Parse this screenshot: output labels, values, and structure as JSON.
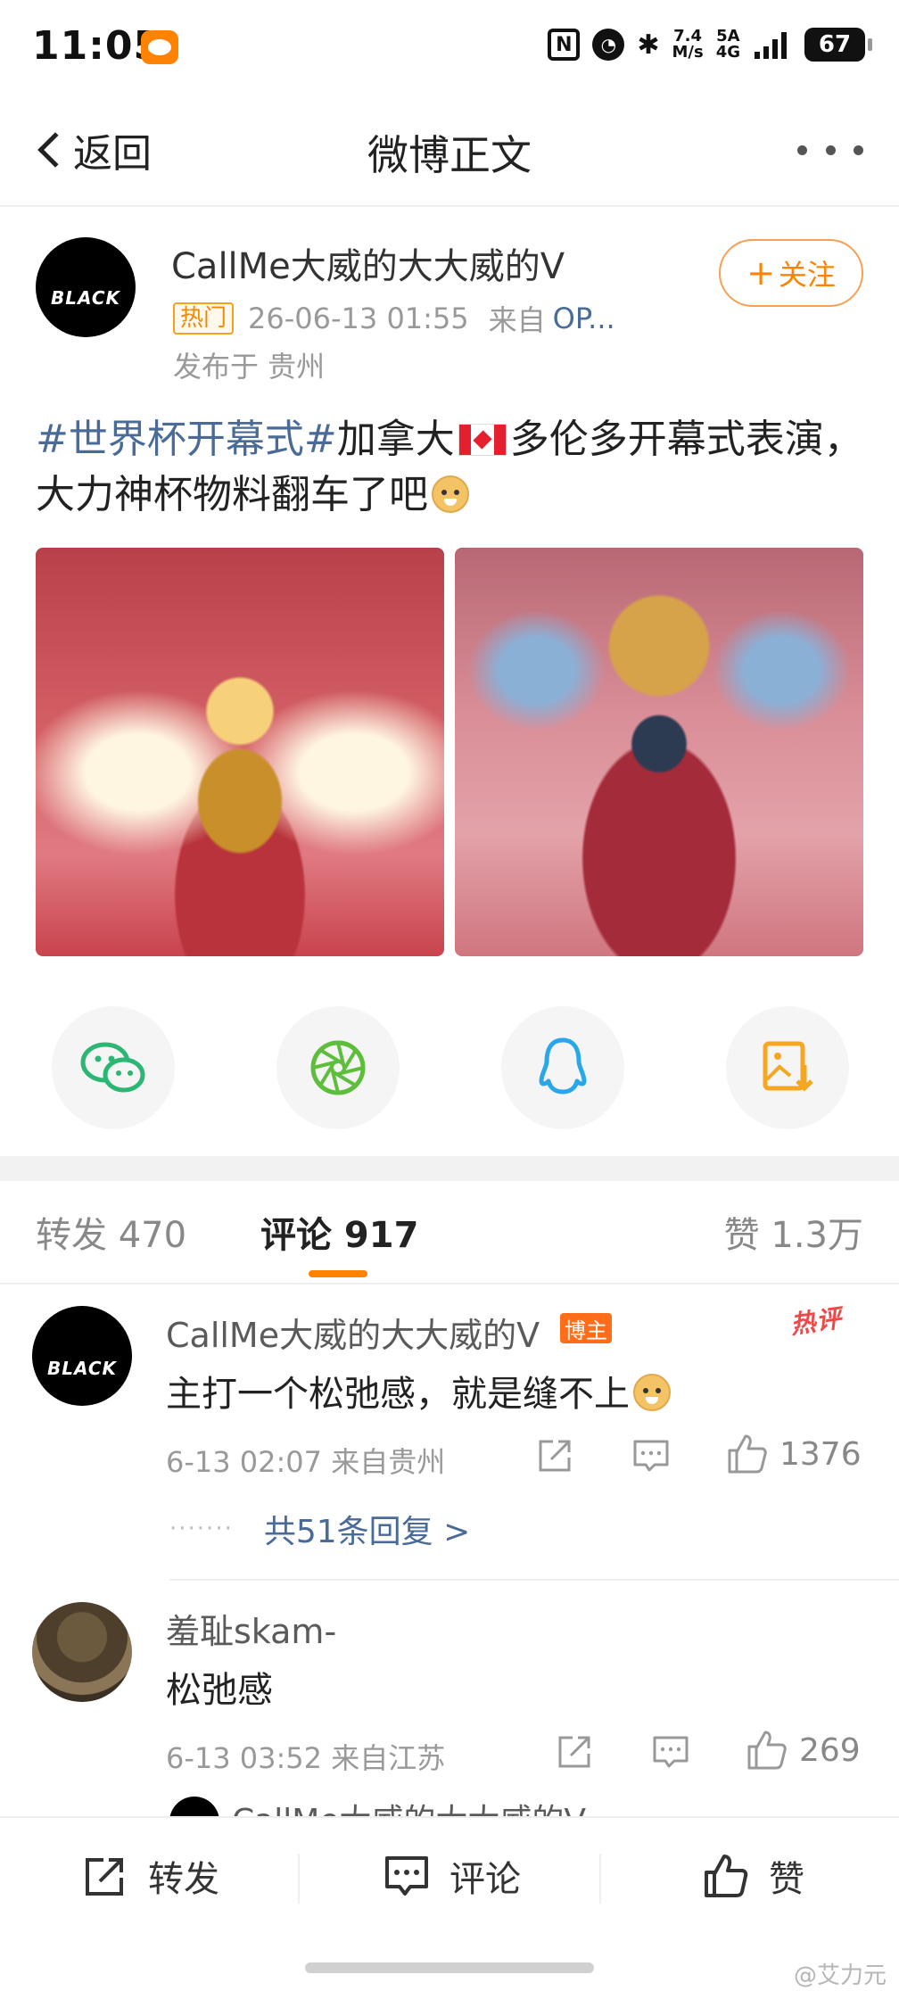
{
  "status_bar": {
    "time": "11:05",
    "net_speed_top": "7.4",
    "net_speed_bottom": "M/s",
    "signal_top": "5A",
    "signal_bottom": "4G",
    "battery": "67"
  },
  "nav": {
    "back_label": "返回",
    "title": "微博正文"
  },
  "post": {
    "author": "CallMe大威的大大威的V",
    "avatar_text": "BLACK",
    "hot_badge": "热门",
    "time": "26-06-13 01:55",
    "source_prefix": "来自",
    "source_device": "OP...",
    "location": "发布于 贵州",
    "follow_label": "关注",
    "hashtag": "#世界杯开幕式#",
    "text_part1": "加拿大",
    "text_part2": "多伦多开幕式表演，大力神杯物料翻车了吧"
  },
  "tabs": {
    "repost": "转发 470",
    "comments": "评论 917",
    "likes": "赞 1.3万"
  },
  "comments": [
    {
      "author": "CallMe大威的大大威的V",
      "badge": "博主",
      "hot_label": "热评",
      "text": "主打一个松弛感，就是缝不上",
      "meta": "6-13 02:07 来自贵州",
      "likes": "1376",
      "replies": "共51条回复 >",
      "avatar_text": "BLACK"
    },
    {
      "author": "羞耻skam-",
      "text": "松弛感",
      "meta": "6-13 03:52 来自江苏",
      "likes": "269"
    }
  ],
  "peek_reply": {
    "author": "CallMe大威的大大威的V"
  },
  "bottom_bar": {
    "repost": "转发",
    "comment": "评论",
    "like": "赞"
  },
  "watermark": "@艾力元",
  "colors": {
    "accent": "#ff8200",
    "link": "#4a6a98",
    "hot_red": "#f04848"
  }
}
